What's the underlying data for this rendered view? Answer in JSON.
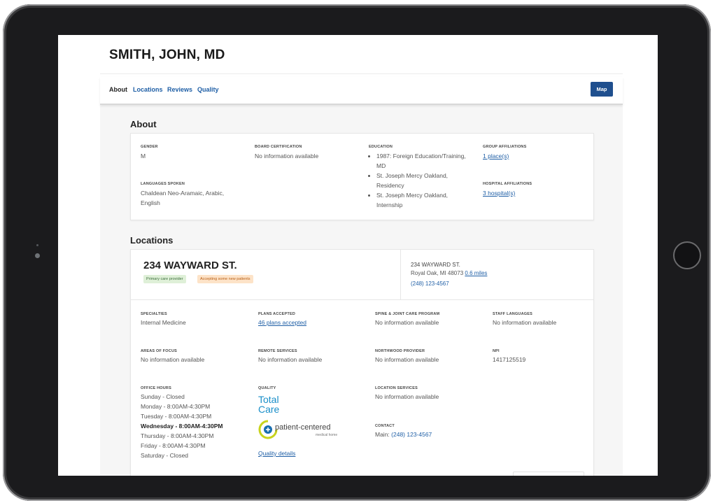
{
  "doctor_name": "SMITH, JOHN, MD",
  "nav": {
    "tabs": [
      "About",
      "Locations",
      "Reviews",
      "Quality"
    ],
    "map_button": "Map"
  },
  "about": {
    "heading": "About",
    "gender": {
      "label": "GENDER",
      "value": "M"
    },
    "board": {
      "label": "BOARD CERTIFICATION",
      "value": "No information available"
    },
    "education": {
      "label": "EDUCATION",
      "items": [
        "1987: Foreign Education/Training, MD",
        "St. Joseph Mercy Oakland, Residency",
        "St. Joseph Mercy Oakland, Internship"
      ]
    },
    "group": {
      "label": "GROUP AFFILIATIONS",
      "value": "1 place(s)"
    },
    "languages": {
      "label": "LANGUAGES SPOKEN",
      "value": "Chaldean Neo-Aramaic,  Arabic, English"
    },
    "hospital": {
      "label": "HOSPITAL AFFILIATIONS",
      "value": "3 hospital(s)"
    }
  },
  "locations": {
    "heading": "Locations",
    "address_title": "234 WAYWARD ST.",
    "badges": {
      "primary": "Primary care provider",
      "accepting": "Accepting some new patients"
    },
    "addr_line1": "234 WAYWARD ST.",
    "addr_line2": "Royal Oak, MI 48073",
    "distance": "0.6 miles",
    "phone": "(248) 123-4567",
    "specialties": {
      "label": "SPECIALTIES",
      "value": "Internal Medicine"
    },
    "plans": {
      "label": "PLANS ACCEPTED",
      "value": "46 plans accepted"
    },
    "spine": {
      "label": "SPINE & JOINT CARE PROGRAM",
      "value": "No information available"
    },
    "staff_lang": {
      "label": "STAFF LANGUAGES",
      "value": "No information available"
    },
    "focus": {
      "label": "AREAS OF FOCUS",
      "value": "No information available"
    },
    "remote": {
      "label": "REMOTE SERVICES",
      "value": "No information available"
    },
    "northwood": {
      "label": "NORTHWOOD PROVIDER",
      "value": "No information available"
    },
    "npi": {
      "label": "NPI",
      "value": "1417125519"
    },
    "hours": {
      "label": "OFFICE HOURS",
      "days": [
        "Sunday - Closed",
        "Monday - 8:00AM-4:30PM",
        "Tuesday - 8:00AM-4:30PM",
        "Wednesday - 8:00AM-4:30PM",
        "Thursday - 8:00AM-4:30PM",
        "Friday - 8:00AM-4:30PM",
        "Saturday - Closed"
      ]
    },
    "quality": {
      "label": "QUALITY",
      "total_care_line1": "Total",
      "total_care_line2": "Care",
      "pcmh_main": "patient-centered",
      "pcmh_sub": "medical home",
      "details_link": "Quality details"
    },
    "loc_services": {
      "label": "LOCATION SERVICES",
      "value": "No information available"
    },
    "contact": {
      "label": "CONTACT",
      "prefix": "Main: ",
      "phone": "(248) 123-4567"
    }
  },
  "colors": {
    "link": "#1f5fa6",
    "primary_badge": "#dff0d8",
    "accepting_badge": "#fde3c8",
    "map_button": "#1f4f8e"
  }
}
